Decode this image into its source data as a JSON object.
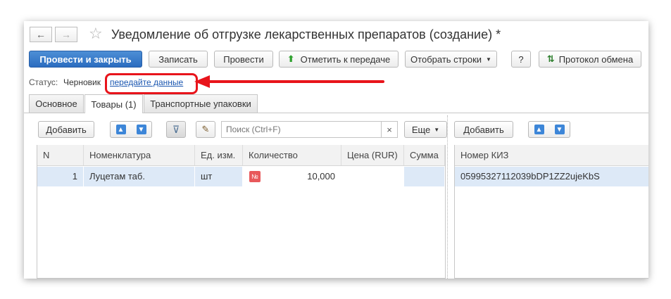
{
  "window": {
    "title": "Уведомление об отгрузке лекарственных препаратов (создание) *",
    "nav_back": "←",
    "nav_forward": "→",
    "star": "☆"
  },
  "toolbar": {
    "post_and_close": "Провести и закрыть",
    "save": "Записать",
    "post": "Провести",
    "mark_for_transfer": "Отметить к передаче",
    "select_rows": "Отобрать строки",
    "help": "?",
    "exchange_log": "Протокол обмена"
  },
  "status": {
    "label": "Статус:",
    "value": "Черновик",
    "link": "передайте данные"
  },
  "tabs": [
    {
      "label": "Основное"
    },
    {
      "label": "Товары (1)"
    },
    {
      "label": "Транспортные упаковки"
    }
  ],
  "left_panel": {
    "add": "Добавить",
    "search_placeholder": "Поиск (Ctrl+F)",
    "clear": "×",
    "more": "Еще",
    "columns": [
      "N",
      "Номенклатура",
      "Ед. изм.",
      "Количество",
      "Цена (RUR)",
      "Сумма"
    ],
    "rows": [
      {
        "n": "1",
        "item": "Луцетам таб.",
        "unit": "шт",
        "qty_badge": "№",
        "qty": "10,000",
        "price": "",
        "sum": ""
      }
    ]
  },
  "right_panel": {
    "add": "Добавить",
    "columns": [
      "Номер КИЗ"
    ],
    "rows": [
      {
        "kiz": "05995327112039bDP1ZZ2ujeKbS"
      }
    ]
  },
  "colors": {
    "primary": "#2b6cc0",
    "annotation": "#e8141b",
    "row_selected": "#dde9f7",
    "link": "#1a56b0"
  }
}
